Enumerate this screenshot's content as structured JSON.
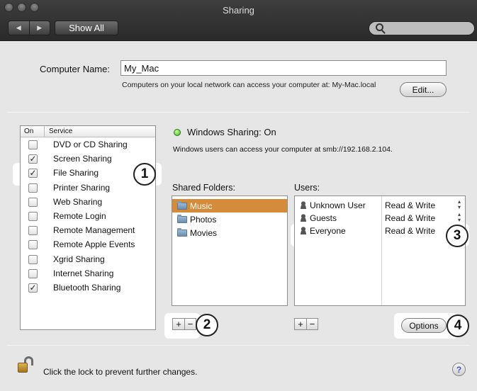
{
  "window": {
    "title": "Sharing"
  },
  "toolbar": {
    "back_icon": "◀",
    "forward_icon": "▶",
    "show_all": "Show All",
    "search_placeholder": ""
  },
  "computer_name": {
    "label": "Computer Name:",
    "value": "My_Mac",
    "note": "Computers on your local network can access your computer at: My-Mac.local",
    "edit_button": "Edit..."
  },
  "services": {
    "header_on": "On",
    "header_service": "Service",
    "items": [
      {
        "label": "DVD or CD Sharing",
        "checked": false
      },
      {
        "label": "Screen Sharing",
        "checked": true
      },
      {
        "label": "File Sharing",
        "checked": true
      },
      {
        "label": "Printer Sharing",
        "checked": false
      },
      {
        "label": "Web Sharing",
        "checked": false
      },
      {
        "label": "Remote Login",
        "checked": false
      },
      {
        "label": "Remote Management",
        "checked": false
      },
      {
        "label": "Remote Apple Events",
        "checked": false
      },
      {
        "label": "Xgrid Sharing",
        "checked": false
      },
      {
        "label": "Internet Sharing",
        "checked": false
      },
      {
        "label": "Bluetooth Sharing",
        "checked": true
      }
    ],
    "check_glyph": "✓"
  },
  "status": {
    "title": "Windows Sharing: On",
    "description": "Windows users can access your computer at smb://192.168.2.104.",
    "indicator_color": "#3fae24"
  },
  "shared_folders": {
    "label": "Shared Folders:",
    "items": [
      "Music",
      "Photos",
      "Movies"
    ],
    "selected": "Music",
    "selection_color": "#d58c3a"
  },
  "users": {
    "label": "Users:",
    "rows": [
      {
        "name": "Unknown User",
        "permission": "Read & Write",
        "icon": "single-user-icon"
      },
      {
        "name": "Guests",
        "permission": "Read & Write",
        "icon": "group-icon"
      },
      {
        "name": "Everyone",
        "permission": "Read & Write",
        "icon": "everyone-icon"
      }
    ]
  },
  "buttons": {
    "add": "+",
    "remove": "−",
    "options": "Options"
  },
  "callouts": [
    "1",
    "2",
    "3",
    "4"
  ],
  "footer": {
    "lock_text": "Click the lock to prevent further changes.",
    "help": "?"
  }
}
